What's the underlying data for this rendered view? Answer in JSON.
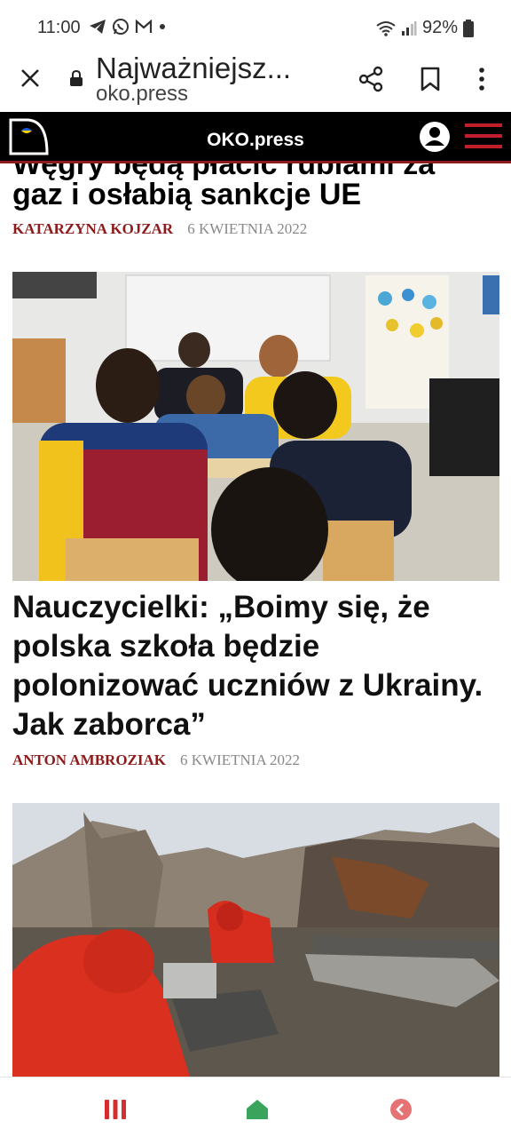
{
  "status_bar": {
    "time": "11:00",
    "battery": "92%",
    "notification_icons": [
      "telegram-icon",
      "whatsapp-icon",
      "gmail-icon",
      "dot-icon"
    ],
    "system_icons": [
      "wifi-icon",
      "signal-icon",
      "battery-icon"
    ]
  },
  "browser": {
    "page_title": "Najważniejsz...",
    "url": "oko.press",
    "actions": [
      "close-icon",
      "share-icon",
      "bookmark-icon",
      "more-icon"
    ]
  },
  "site": {
    "title": "OKO.press",
    "colors": {
      "accent": "#8e1b1b",
      "menu": "#c1202a",
      "header_bg": "#000000"
    }
  },
  "articles": [
    {
      "headline_cut": "Węgry będą płacić rublami za",
      "headline": "gaz i osłabią sankcje UE",
      "author": "KATARZYNA KOJZAR",
      "date": "6 KWIETNIA 2022"
    },
    {
      "headline": "Nauczycielki: „Boimy się, że polska szkoła będzie polonizować uczniów z Ukrainy. Jak zaborca”",
      "author": "ANTON AMBROZIAK",
      "date": "6 KWIETNIA 2022",
      "image": "classroom-photo"
    },
    {
      "image": "ruins-photo"
    }
  ],
  "bottom_nav": [
    "recent-apps-icon",
    "home-icon",
    "back-icon"
  ]
}
